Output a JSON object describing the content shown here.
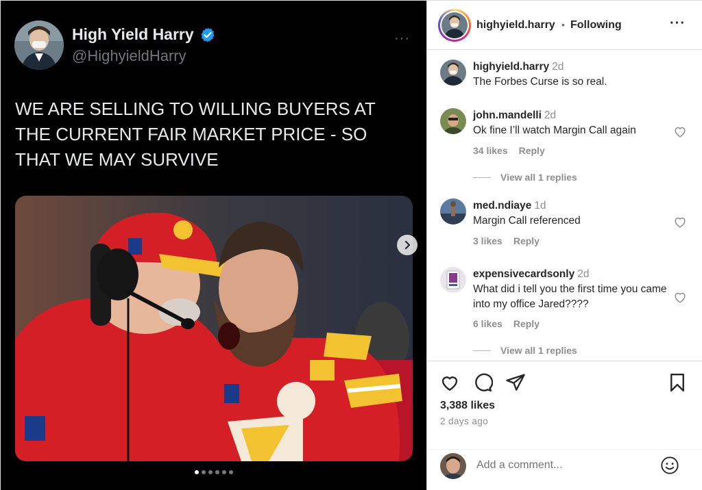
{
  "tweet": {
    "display_name": "High Yield Harry",
    "handle": "@HighyieldHarry",
    "more_label": "···",
    "text": "WE ARE SELLING TO WILLING BUYERS AT THE CURRENT FAIR MARKET PRICE - SO THAT WE MAY SURVIVE",
    "verified_icon": "verified-badge-icon"
  },
  "carousel": {
    "slide_count": 6,
    "active_index": 0,
    "next_icon": "chevron-right-icon"
  },
  "post_header": {
    "username": "highyield.harry",
    "separator": "•",
    "follow_status": "Following",
    "more_label": "···"
  },
  "caption": {
    "username": "highyield.harry",
    "time": "2d",
    "text": "The Forbes Curse is so real."
  },
  "comments": [
    {
      "username": "john.mandelli",
      "time": "2d",
      "text": "Ok fine I’ll watch Margin Call again",
      "likes": "34 likes",
      "reply": "Reply",
      "view_replies": "View all 1 replies"
    },
    {
      "username": "med.ndiaye",
      "time": "1d",
      "text": "Margin Call referenced",
      "likes": "3 likes",
      "reply": "Reply"
    },
    {
      "username": "expensivecardsonly",
      "time": "2d",
      "text": "What did i tell you the first time you came into my office Jared????",
      "likes": "6 likes",
      "reply": "Reply",
      "view_replies": "View all 1 replies"
    }
  ],
  "post_stats": {
    "likes": "3,388 likes",
    "posted": "2 days ago"
  },
  "comment_box": {
    "placeholder": "Add a comment..."
  },
  "colors": {
    "media_bg": "#000000",
    "text_muted": "#8e8e8e",
    "chiefs_red": "#d51f26",
    "chiefs_gold": "#f2c230",
    "verified_blue": "#1d9bf0"
  }
}
